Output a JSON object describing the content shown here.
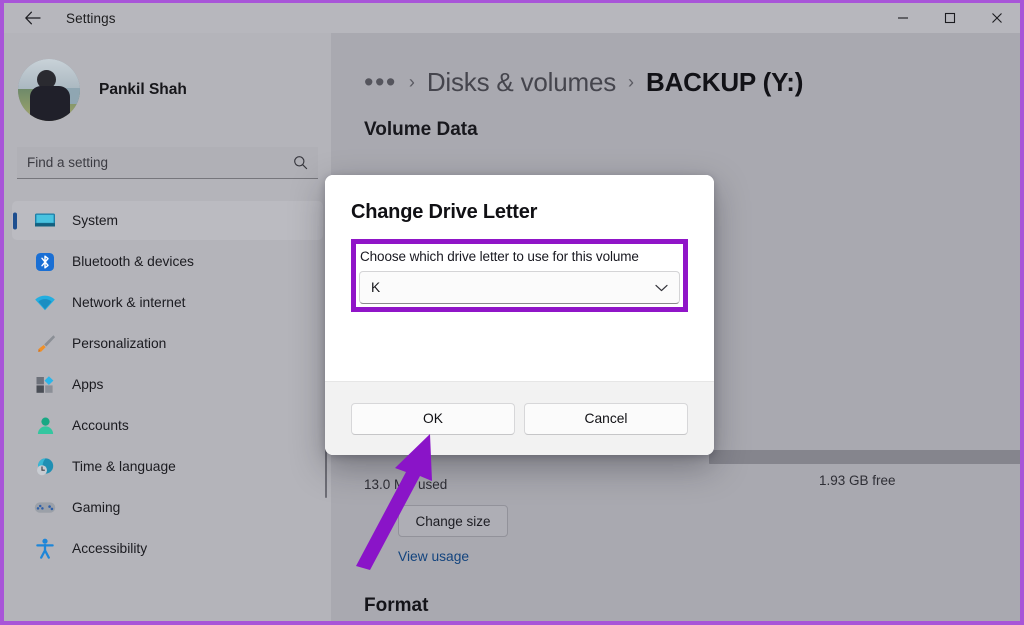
{
  "window": {
    "app_title": "Settings",
    "back_icon": "back-arrow-icon",
    "controls": {
      "minimize": "minimize-icon",
      "maximize": "maximize-icon",
      "close": "close-icon"
    },
    "frame_accent_color": "#a855d8"
  },
  "sidebar": {
    "account": {
      "user_name": "Pankil Shah",
      "avatar": "user-avatar"
    },
    "search": {
      "placeholder": "Find a setting",
      "icon": "search-icon"
    },
    "items": [
      {
        "label": "System",
        "icon": "monitor-icon",
        "selected": true
      },
      {
        "label": "Bluetooth & devices",
        "icon": "bluetooth-icon",
        "selected": false
      },
      {
        "label": "Network & internet",
        "icon": "wifi-icon",
        "selected": false
      },
      {
        "label": "Personalization",
        "icon": "paintbrush-icon",
        "selected": false
      },
      {
        "label": "Apps",
        "icon": "apps-grid-icon",
        "selected": false
      },
      {
        "label": "Accounts",
        "icon": "person-icon",
        "selected": false
      },
      {
        "label": "Time & language",
        "icon": "clock-globe-icon",
        "selected": false
      },
      {
        "label": "Gaming",
        "icon": "gamepad-icon",
        "selected": false
      },
      {
        "label": "Accessibility",
        "icon": "accessibility-icon",
        "selected": false
      }
    ]
  },
  "main": {
    "breadcrumb": {
      "ellipsis": "•••",
      "separator": "›",
      "parent": "Disks & volumes",
      "current": "BACKUP (Y:)"
    },
    "volume_data_heading": "Volume Data",
    "usage": {
      "used_label": "13.0 MB used",
      "free_label": "1.93 GB free",
      "bar_fill_percent": 99
    },
    "change_size_label": "Change size",
    "view_usage_label": "View usage",
    "format_heading": "Format"
  },
  "dialog": {
    "title": "Change Drive Letter",
    "field_label": "Choose which drive letter to use for this volume",
    "selected_drive_letter": "K",
    "dropdown_icon": "chevron-down-icon",
    "ok_label": "OK",
    "cancel_label": "Cancel",
    "highlight_color": "#9015c8"
  },
  "annotation": {
    "arrow": "purple-arrow-pointing-to-ok-button",
    "color": "#8a14c8"
  }
}
